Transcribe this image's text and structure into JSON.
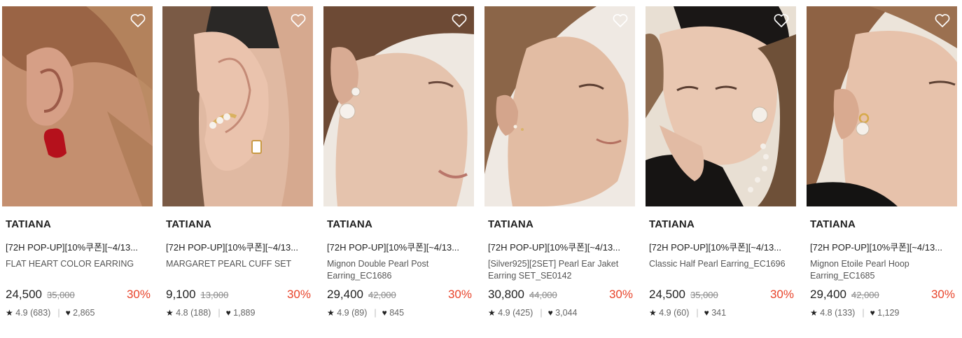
{
  "products": [
    {
      "brand": "TATIANA",
      "promo": "[72H POP-UP][10%쿠폰][~4/13...",
      "name": "FLAT HEART COLOR EARRING",
      "price": "24,500",
      "original_price": "35,000",
      "discount": "30%",
      "rating": "4.9",
      "reviews": "(683)",
      "likes": "2,865"
    },
    {
      "brand": "TATIANA",
      "promo": "[72H POP-UP][10%쿠폰][~4/13...",
      "name": "MARGARET PEARL CUFF SET",
      "price": "9,100",
      "original_price": "13,000",
      "discount": "30%",
      "rating": "4.8",
      "reviews": "(188)",
      "likes": "1,889"
    },
    {
      "brand": "TATIANA",
      "promo": "[72H POP-UP][10%쿠폰][~4/13...",
      "name": "Mignon Double Pearl Post Earring_EC1686",
      "price": "29,400",
      "original_price": "42,000",
      "discount": "30%",
      "rating": "4.9",
      "reviews": "(89)",
      "likes": "845"
    },
    {
      "brand": "TATIANA",
      "promo": "[72H POP-UP][10%쿠폰][~4/13...",
      "name": "[Silver925][2SET] Pearl Ear Jaket Earring SET_SE0142",
      "price": "30,800",
      "original_price": "44,000",
      "discount": "30%",
      "rating": "4.9",
      "reviews": "(425)",
      "likes": "3,044"
    },
    {
      "brand": "TATIANA",
      "promo": "[72H POP-UP][10%쿠폰][~4/13...",
      "name": "Classic Half Pearl Earring_EC1696",
      "price": "24,500",
      "original_price": "35,000",
      "discount": "30%",
      "rating": "4.9",
      "reviews": "(60)",
      "likes": "341"
    },
    {
      "brand": "TATIANA",
      "promo": "[72H POP-UP][10%쿠폰][~4/13...",
      "name": "Mignon Etoile Pearl Hoop Earring_EC1685",
      "price": "29,400",
      "original_price": "42,000",
      "discount": "30%",
      "rating": "4.8",
      "reviews": "(133)",
      "likes": "1,129"
    }
  ],
  "icons": {
    "wishlist": "heart-outline-icon",
    "rating": "star-icon",
    "likes": "heart-filled-icon"
  },
  "colors": {
    "discount": "#e8442b",
    "original_price": "#8a8a8a",
    "text": "#1f1f1f"
  }
}
